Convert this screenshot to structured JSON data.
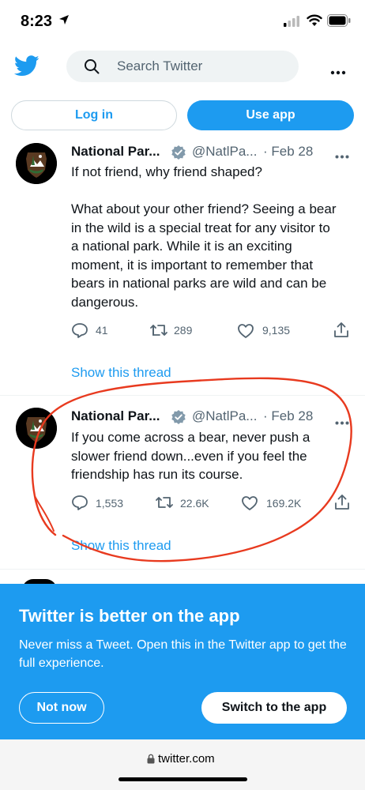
{
  "status": {
    "time": "8:23"
  },
  "search": {
    "placeholder": "Search Twitter"
  },
  "auth": {
    "login_label": "Log in",
    "use_app_label": "Use app"
  },
  "tweets": [
    {
      "name": "National Par...",
      "handle": "@NatlPa...",
      "date": "· Feb 28",
      "text_lines": [
        "If not friend, why friend shaped?",
        "",
        "What about your other friend? Seeing a bear",
        "in the wild is a special treat for any visitor to",
        "a national park. While it is an exciting",
        "moment, it is important to remember that",
        "bears in national parks are wild and can be",
        "dangerous."
      ],
      "replies": "41",
      "retweets": "289",
      "likes": "9,135",
      "show_thread": "Show this thread"
    },
    {
      "name": "National Par...",
      "handle": "@NatlPa...",
      "date": "· Feb 28",
      "text_lines": [
        "If you come across a bear, never push a",
        "slower friend down...even if you feel the",
        "friendship has run its course."
      ],
      "replies": "1,553",
      "retweets": "22.6K",
      "likes": "169.2K",
      "show_thread": "Show this thread"
    }
  ],
  "banner": {
    "title": "Twitter is better on the app",
    "text": "Never miss a Tweet. Open this in the Twitter app to get the full experience.",
    "not_now_label": "Not now",
    "switch_label": "Switch to the app"
  },
  "browser": {
    "url": "twitter.com"
  },
  "colors": {
    "accent": "#1d9bf0",
    "annotation": "#e83a1f"
  },
  "icons": [
    "location-arrow-icon",
    "signal-icon",
    "wifi-icon",
    "battery-icon",
    "twitter-bird-icon",
    "search-icon",
    "more-icon",
    "verified-icon",
    "reply-icon",
    "retweet-icon",
    "like-icon",
    "share-icon",
    "lock-icon"
  ]
}
